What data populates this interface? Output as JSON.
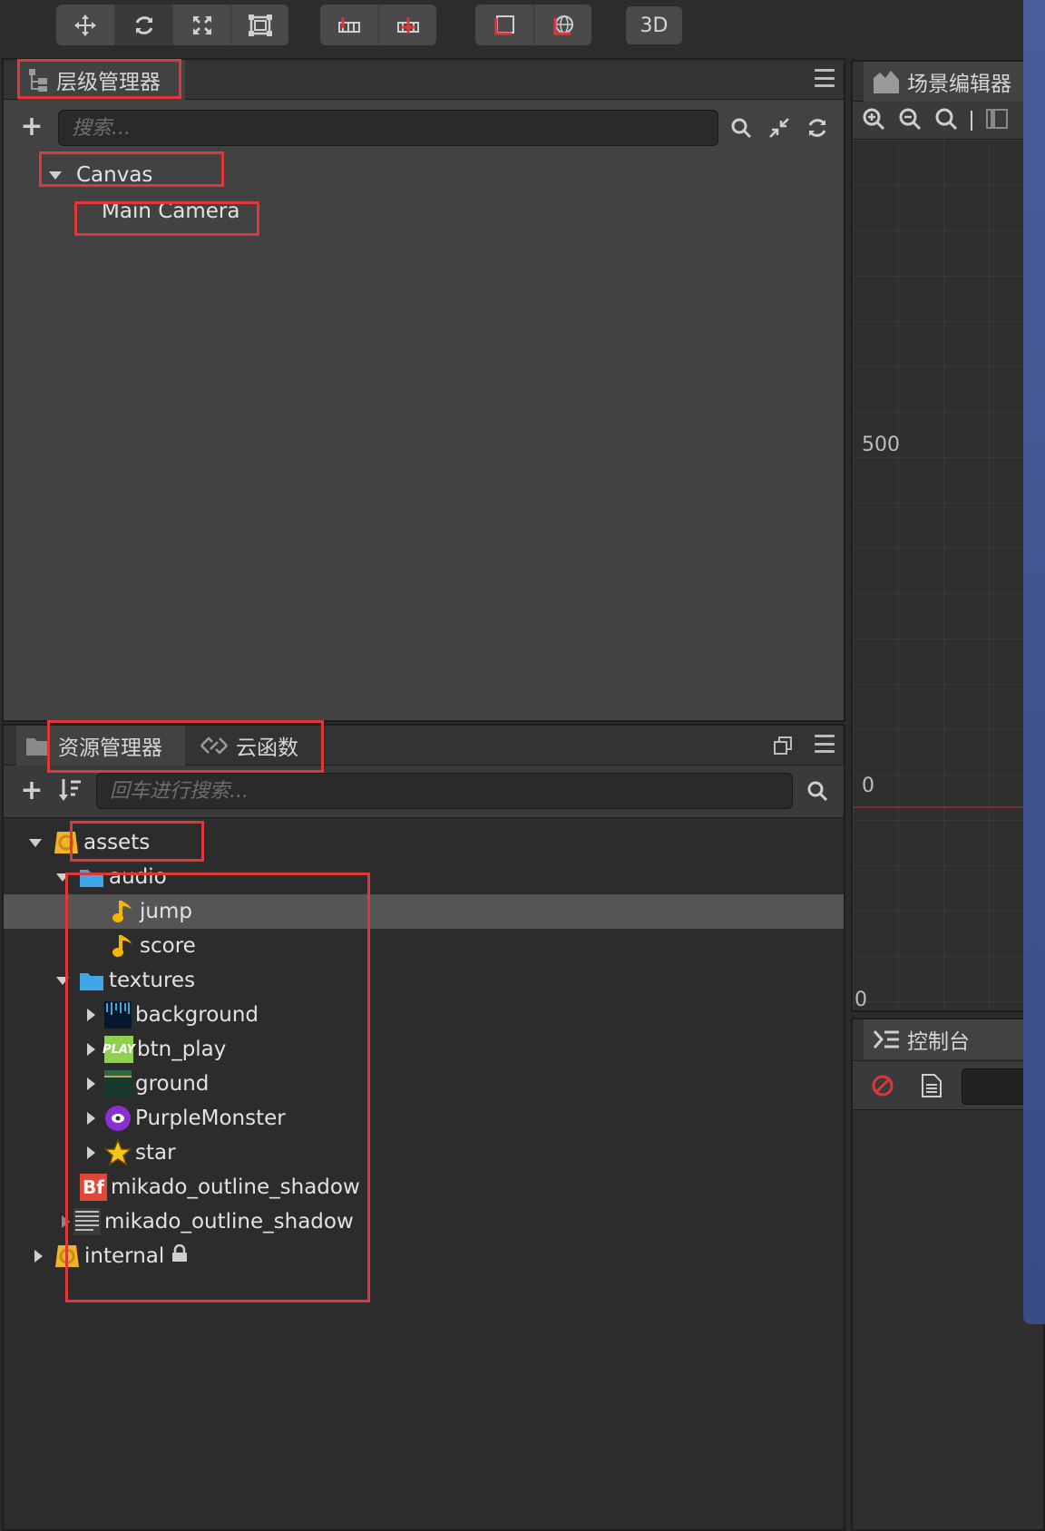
{
  "toolbar": {
    "group1": [
      "move-icon",
      "rotate-icon",
      "scale-icon",
      "rect-icon"
    ],
    "group2": [
      "pivot-icon",
      "center-icon"
    ],
    "group3": [
      "local-icon",
      "global-icon"
    ],
    "mode_3d": "3D"
  },
  "hierarchy": {
    "title": "层级管理器",
    "search_placeholder": "搜索...",
    "nodes": [
      {
        "label": "Canvas"
      },
      {
        "label": "Main Camera"
      }
    ]
  },
  "assets": {
    "tab_assets": "资源管理器",
    "tab_cloud": "云函数",
    "search_placeholder": "回车进行搜索...",
    "tree": {
      "root": "assets",
      "audio": "audio",
      "jump": "jump",
      "score": "score",
      "textures": "textures",
      "background": "background",
      "btn_play": "btn_play",
      "play_icon_text": "PLAY",
      "ground": "ground",
      "purple": "PurpleMonster",
      "star": "star",
      "font1": "mikado_outline_shadow",
      "bf_icon_text": "Bf",
      "font2": "mikado_outline_shadow",
      "internal": "internal"
    }
  },
  "scene": {
    "title": "场景编辑器",
    "label_500": "500",
    "label_0a": "0",
    "label_0b": "0"
  },
  "console": {
    "title": "控制台"
  },
  "colors": {
    "highlight": "#e0373b",
    "folder": "#3fa7e8",
    "audio": "#f5b700"
  }
}
